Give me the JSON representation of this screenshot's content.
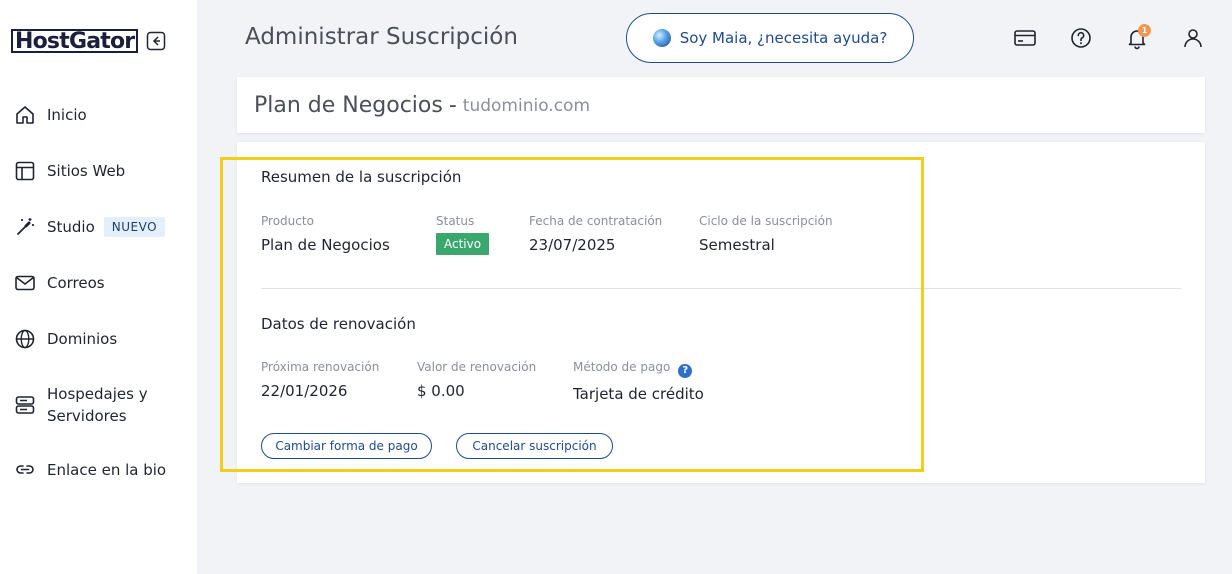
{
  "brand": {
    "logo": "HostGator"
  },
  "sidebar": {
    "items": [
      {
        "label": "Inicio",
        "icon": "home-icon"
      },
      {
        "label": "Sitios Web",
        "icon": "layout-icon"
      },
      {
        "label": "Studio",
        "icon": "magic-wand-icon",
        "badge": "NUEVO"
      },
      {
        "label": "Correos",
        "icon": "mail-icon"
      },
      {
        "label": "Dominios",
        "icon": "globe-icon"
      },
      {
        "label": "Hospedajes y Servidores",
        "icon": "server-icon"
      },
      {
        "label": "Enlace en la bio",
        "icon": "link-icon"
      }
    ]
  },
  "header": {
    "title": "Administrar Suscripción",
    "assistant": "Soy Maia, ¿necesita ayuda?",
    "notification_count": "1"
  },
  "plan": {
    "name": "Plan de Negocios",
    "separator": "-",
    "domain": "tudominio.com"
  },
  "summary": {
    "title": "Resumen de la suscripción",
    "product_label": "Producto",
    "product_value": "Plan de Negocios",
    "status_label": "Status",
    "status_value": "Activo",
    "date_label": "Fecha de contratación",
    "date_value": "23/07/2025",
    "cycle_label": "Ciclo de la suscripción",
    "cycle_value": "Semestral"
  },
  "renewal": {
    "title": "Datos de renovación",
    "next_label": "Próxima renovación",
    "next_value": "22/01/2026",
    "amount_label": "Valor de renovación",
    "amount_value": "$ 0.00",
    "method_label": "Método de pago",
    "method_value": "Tarjeta de crédito",
    "change_button": "Cambiar forma de pago",
    "cancel_button": "Cancelar suscripción"
  },
  "colors": {
    "accent": "#1f4a8f",
    "active": "#3aa76d",
    "highlight": "#f2cd1c",
    "badge_notif": "#f3994f"
  }
}
